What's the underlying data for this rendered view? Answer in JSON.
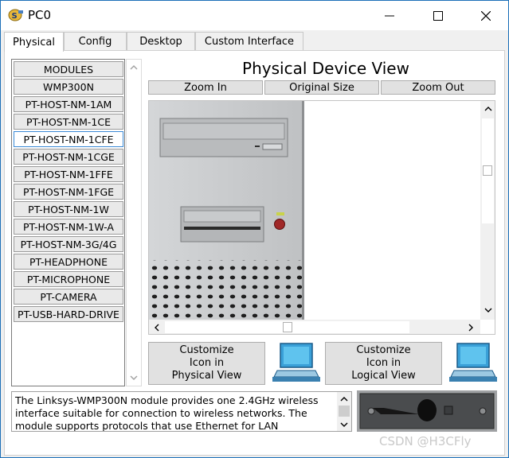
{
  "window": {
    "title": "PC0",
    "minimize": "—",
    "maximize": "☐",
    "close": "✕"
  },
  "tabs": [
    {
      "label": "Physical",
      "active": true
    },
    {
      "label": "Config",
      "active": false
    },
    {
      "label": "Desktop",
      "active": false
    },
    {
      "label": "Custom Interface",
      "active": false
    }
  ],
  "modules": {
    "items": [
      "MODULES",
      "WMP300N",
      "PT-HOST-NM-1AM",
      "PT-HOST-NM-1CE",
      "PT-HOST-NM-1CFE",
      "PT-HOST-NM-1CGE",
      "PT-HOST-NM-1FFE",
      "PT-HOST-NM-1FGE",
      "PT-HOST-NM-1W",
      "PT-HOST-NM-1W-A",
      "PT-HOST-NM-3G/4G",
      "PT-HEADPHONE",
      "PT-MICROPHONE",
      "PT-CAMERA",
      "PT-USB-HARD-DRIVE"
    ],
    "selected": "PT-HOST-NM-1CFE"
  },
  "physical_view": {
    "title": "Physical Device View",
    "zoom_in": "Zoom In",
    "original_size": "Original Size",
    "zoom_out": "Zoom Out"
  },
  "customize": {
    "physical": "Customize\nIcon in\nPhysical View",
    "logical": "Customize\nIcon in\nLogical View"
  },
  "description": "The Linksys-WMP300N module provides one 2.4GHz wireless interface suitable for connection to wireless networks. The module supports protocols that use Ethernet for LAN",
  "watermark": "CSDN @H3CFly",
  "colors": {
    "window_border": "#1c6fb8",
    "selection": "#3b8ad6",
    "pc_case": "#c8cacc"
  }
}
